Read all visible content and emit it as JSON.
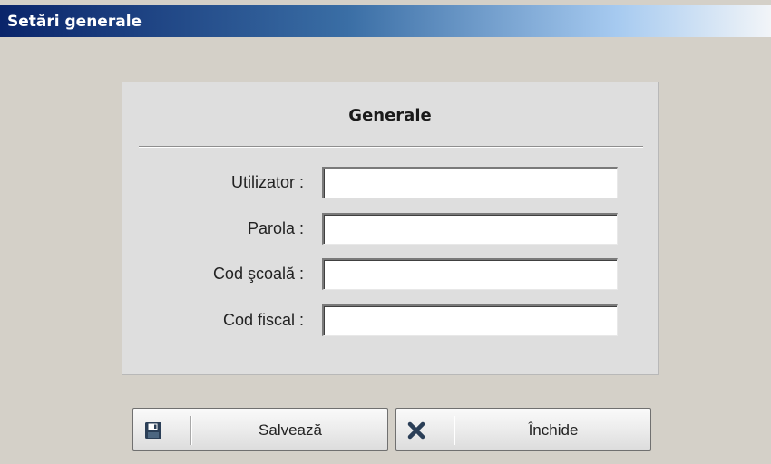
{
  "window": {
    "title": "Setări generale"
  },
  "panel": {
    "title": "Generale",
    "fields": [
      {
        "label": "Utilizator :",
        "value": ""
      },
      {
        "label": "Parola :",
        "value": ""
      },
      {
        "label": "Cod şcoală :",
        "value": ""
      },
      {
        "label": "Cod fiscal :",
        "value": ""
      }
    ]
  },
  "buttons": {
    "save": {
      "label": "Salvează",
      "icon": "floppy-disk-icon"
    },
    "close": {
      "label": "Închide",
      "icon": "close-x-icon"
    }
  },
  "colors": {
    "titlebar_start": "#0a246a",
    "titlebar_end": "#f2f5f8",
    "background": "#d4d0c8",
    "panel": "#dedede",
    "save_icon": "#2b3f57",
    "close_icon": "#2b3f57"
  }
}
